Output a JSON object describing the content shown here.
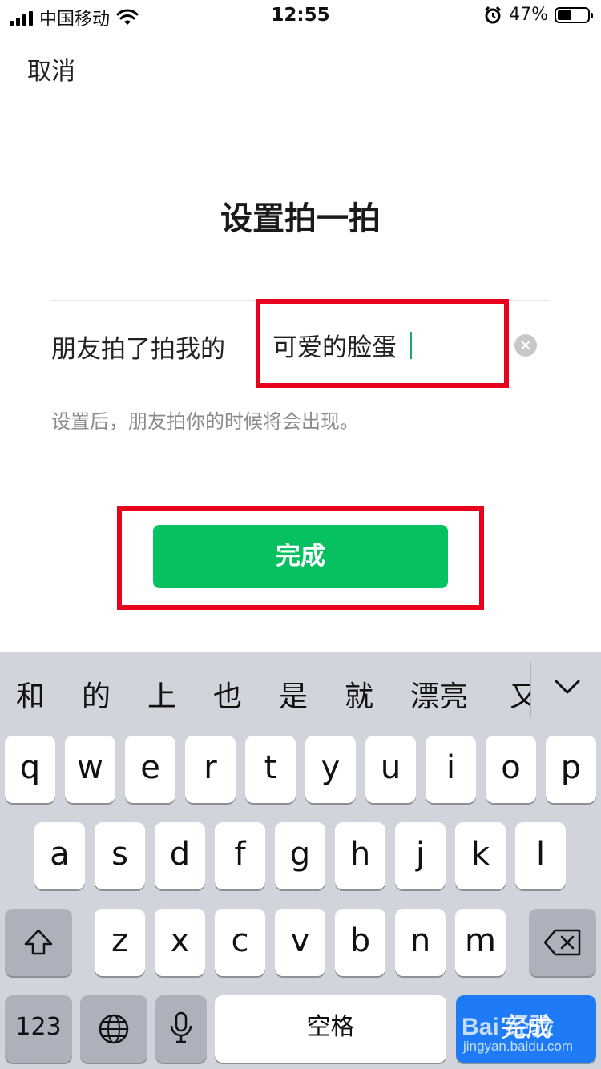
{
  "status_bar": {
    "carrier": "中国移动",
    "time": "12:55",
    "battery": "47%",
    "battery_level": 0.47
  },
  "nav": {
    "cancel_label": "取消"
  },
  "page": {
    "title": "设置拍一拍",
    "row_label": "朋友拍了拍我的",
    "input_value": "可爱的脸蛋",
    "hint": "设置后，朋友拍你的时候将会出现。",
    "done_label": "完成"
  },
  "keyboard": {
    "candidates": [
      "和",
      "的",
      "上",
      "也",
      "是",
      "就",
      "漂亮",
      "又"
    ],
    "row1": [
      "q",
      "w",
      "e",
      "r",
      "t",
      "y",
      "u",
      "i",
      "o",
      "p"
    ],
    "row2": [
      "a",
      "s",
      "d",
      "f",
      "g",
      "h",
      "j",
      "k",
      "l"
    ],
    "row3": [
      "z",
      "x",
      "c",
      "v",
      "b",
      "n",
      "m"
    ],
    "numbers_label": "123",
    "space_label": "空格",
    "return_label": "完成"
  },
  "watermark": {
    "brand": "Bai 经验",
    "url": "jingyan.baidu.com"
  },
  "colors": {
    "accent_green": "#07c160",
    "highlight_red": "#e8001c",
    "return_blue": "#1e7bf5"
  }
}
